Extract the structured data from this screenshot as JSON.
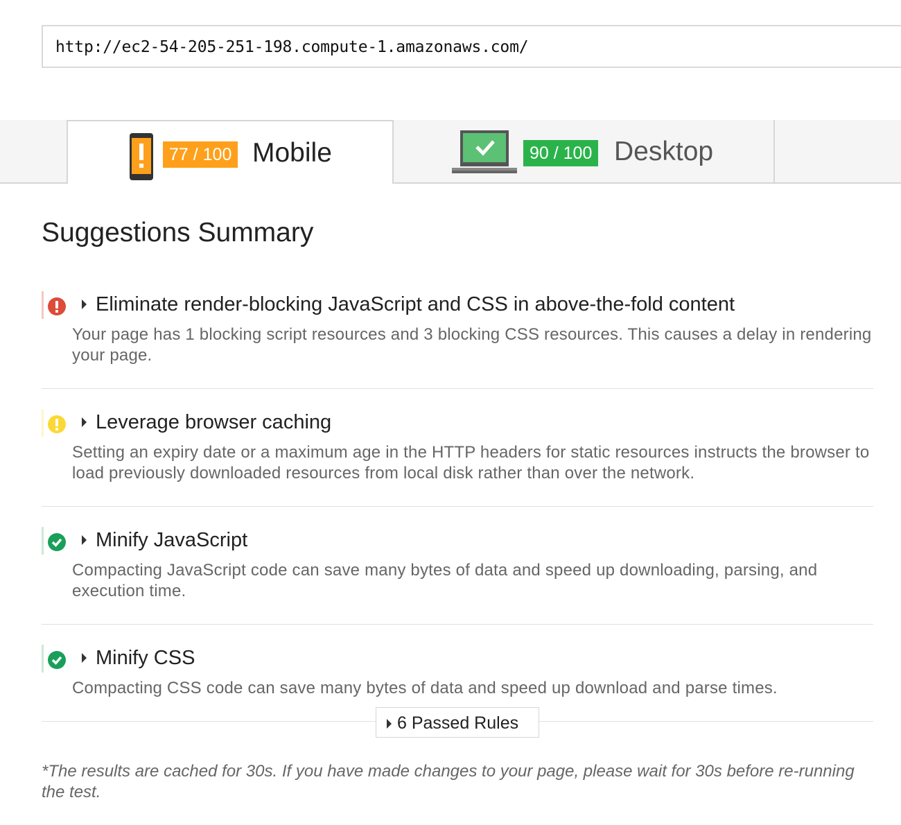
{
  "url_input": {
    "value": "http://ec2-54-205-251-198.compute-1.amazonaws.com/"
  },
  "tabs": [
    {
      "label": "Mobile",
      "score": "77 / 100",
      "icon": "mobile-phone-warning-icon",
      "score_color": "#fea01b",
      "active": true
    },
    {
      "label": "Desktop",
      "score": "90 / 100",
      "icon": "laptop-check-icon",
      "score_color": "#2bb34b",
      "active": false
    }
  ],
  "summary": {
    "title": "Suggestions Summary",
    "rules": [
      {
        "title": "Eliminate render-blocking JavaScript and CSS in above-the-fold content",
        "description": "Your page has 1 blocking script resources and 3 blocking CSS resources. This causes a delay in rendering your page.",
        "status": "error",
        "icon": "error-icon",
        "color": "#dd4b39"
      },
      {
        "title": "Leverage browser caching",
        "description": "Setting an expiry date or a maximum age in the HTTP headers for static resources instructs the browser to load previously downloaded resources from local disk rather than over the network.",
        "status": "warning",
        "icon": "warning-icon",
        "color": "#fcd837"
      },
      {
        "title": "Minify JavaScript",
        "description": "Compacting JavaScript code can save many bytes of data and speed up downloading, parsing, and execution time.",
        "status": "passed",
        "icon": "check-icon",
        "color": "#1a9f5a"
      },
      {
        "title": "Minify CSS",
        "description": "Compacting CSS code can save many bytes of data and speed up download and parse times.",
        "status": "passed",
        "icon": "check-icon",
        "color": "#1a9f5a"
      }
    ],
    "passed_rules_label": "6 Passed Rules"
  },
  "footnote": "*The results are cached for 30s. If you have made changes to your page, please wait for 30s before re-running the test."
}
